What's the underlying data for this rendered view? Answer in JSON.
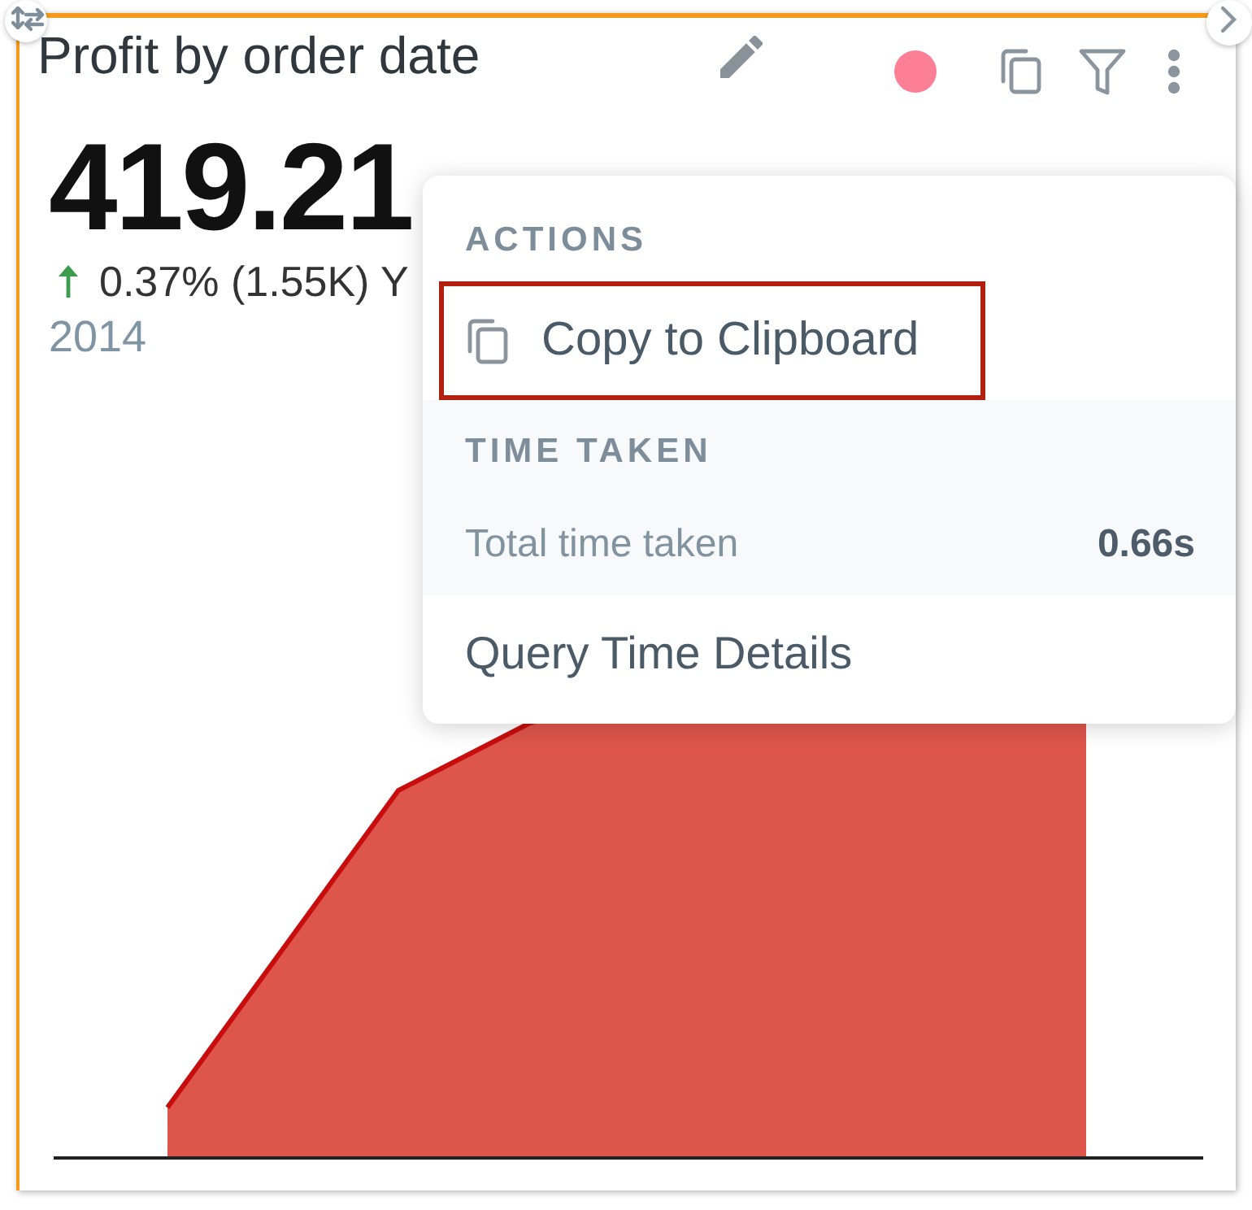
{
  "widget": {
    "title": "Profit by order date"
  },
  "kpi": {
    "value": "419.21",
    "change": {
      "increase": true,
      "text": "0.37% (1.55K) Y"
    },
    "period": "2014"
  },
  "menu": {
    "sections": [
      {
        "kind": "actions",
        "title": "ACTIONS",
        "items": [
          {
            "label": "Copy to Clipboard",
            "highlighted": true
          }
        ]
      },
      {
        "kind": "stats",
        "title": "TIME TAKEN",
        "items": [
          {
            "label": "Total time taken",
            "value": "0.66s"
          }
        ]
      },
      {
        "kind": "links",
        "items": [
          {
            "label": "Query Time Details",
            "highlighted": false
          }
        ]
      }
    ]
  }
}
